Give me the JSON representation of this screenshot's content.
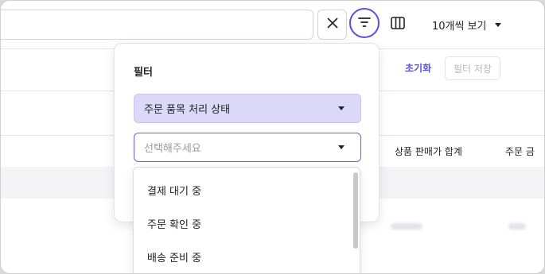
{
  "toolbar": {
    "search": {
      "value": ""
    },
    "clear_icon": "close-icon",
    "filter_icon": "filter-icon",
    "columns_icon": "columns-icon",
    "page_size": "10개씩 보기",
    "accent_color": "#5b4fe0"
  },
  "table": {
    "reset_label": "초기화",
    "save_filter_label": "필터 저장",
    "headers": [
      "상품 판매가 합계",
      "주문 금"
    ]
  },
  "filter_popover": {
    "title": "필터",
    "field_select": "주문 품목 처리 상태",
    "value_select_placeholder": "선택해주세요",
    "options": [
      "결제 대기 중",
      "주문 확인 중",
      "배송 준비 중"
    ]
  }
}
